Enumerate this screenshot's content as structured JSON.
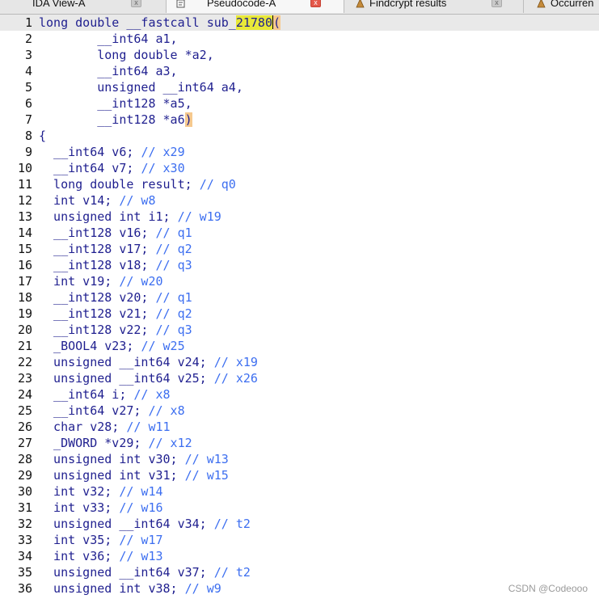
{
  "tabs": [
    {
      "label": "IDA View-A",
      "close": "x",
      "active": false,
      "close_style": "grey"
    },
    {
      "label": "Pseudocode-A",
      "close": "x",
      "active": true,
      "close_style": "red"
    },
    {
      "label": "Findcrypt results",
      "close": "x",
      "active": false,
      "close_style": "grey"
    },
    {
      "label": "Occurren",
      "close": "",
      "active": false,
      "close_style": "none"
    }
  ],
  "colors": {
    "code_text": "#1f1f8f",
    "comment": "#3c6ef0",
    "highlight_identifier": "#e8e839",
    "highlight_paren": "#f6c98e",
    "current_line_bg": "#e9e9e9"
  },
  "code": {
    "lines": [
      {
        "n": "1",
        "text": "long double __fastcall sub_",
        "hl": "21780",
        "hl2": "(",
        "comment": "",
        "current": true
      },
      {
        "n": "2",
        "text": "        __int64 a1,",
        "comment": ""
      },
      {
        "n": "3",
        "text": "        long double *a2,",
        "comment": ""
      },
      {
        "n": "4",
        "text": "        __int64 a3,",
        "comment": ""
      },
      {
        "n": "5",
        "text": "        unsigned __int64 a4,",
        "comment": ""
      },
      {
        "n": "6",
        "text": "        __int128 *a5,",
        "comment": ""
      },
      {
        "n": "7",
        "text": "        __int128 *a6",
        "hl2": ")",
        "comment": ""
      },
      {
        "n": "8",
        "text": "{",
        "comment": ""
      },
      {
        "n": "9",
        "text": "  __int64 v6; ",
        "comment": "// x29"
      },
      {
        "n": "10",
        "text": "  __int64 v7; ",
        "comment": "// x30"
      },
      {
        "n": "11",
        "text": "  long double result; ",
        "comment": "// q0"
      },
      {
        "n": "12",
        "text": "  int v14; ",
        "comment": "// w8"
      },
      {
        "n": "13",
        "text": "  unsigned int i1; ",
        "comment": "// w19"
      },
      {
        "n": "14",
        "text": "  __int128 v16; ",
        "comment": "// q1"
      },
      {
        "n": "15",
        "text": "  __int128 v17; ",
        "comment": "// q2"
      },
      {
        "n": "16",
        "text": "  __int128 v18; ",
        "comment": "// q3"
      },
      {
        "n": "17",
        "text": "  int v19; ",
        "comment": "// w20"
      },
      {
        "n": "18",
        "text": "  __int128 v20; ",
        "comment": "// q1"
      },
      {
        "n": "19",
        "text": "  __int128 v21; ",
        "comment": "// q2"
      },
      {
        "n": "20",
        "text": "  __int128 v22; ",
        "comment": "// q3"
      },
      {
        "n": "21",
        "text": "  _BOOL4 v23; ",
        "comment": "// w25"
      },
      {
        "n": "22",
        "text": "  unsigned __int64 v24; ",
        "comment": "// x19"
      },
      {
        "n": "23",
        "text": "  unsigned __int64 v25; ",
        "comment": "// x26"
      },
      {
        "n": "24",
        "text": "  __int64 i; ",
        "comment": "// x8"
      },
      {
        "n": "25",
        "text": "  __int64 v27; ",
        "comment": "// x8"
      },
      {
        "n": "26",
        "text": "  char v28; ",
        "comment": "// w11"
      },
      {
        "n": "27",
        "text": "  _DWORD *v29; ",
        "comment": "// x12"
      },
      {
        "n": "28",
        "text": "  unsigned int v30; ",
        "comment": "// w13"
      },
      {
        "n": "29",
        "text": "  unsigned int v31; ",
        "comment": "// w15"
      },
      {
        "n": "30",
        "text": "  int v32; ",
        "comment": "// w14"
      },
      {
        "n": "31",
        "text": "  int v33; ",
        "comment": "// w16"
      },
      {
        "n": "32",
        "text": "  unsigned __int64 v34; ",
        "comment": "// t2"
      },
      {
        "n": "33",
        "text": "  int v35; ",
        "comment": "// w17"
      },
      {
        "n": "34",
        "text": "  int v36; ",
        "comment": "// w13"
      },
      {
        "n": "35",
        "text": "  unsigned __int64 v37; ",
        "comment": "// t2"
      },
      {
        "n": "36",
        "text": "  unsigned int v38; ",
        "comment": "// w9"
      }
    ]
  },
  "watermark": "CSDN @Codeooo"
}
